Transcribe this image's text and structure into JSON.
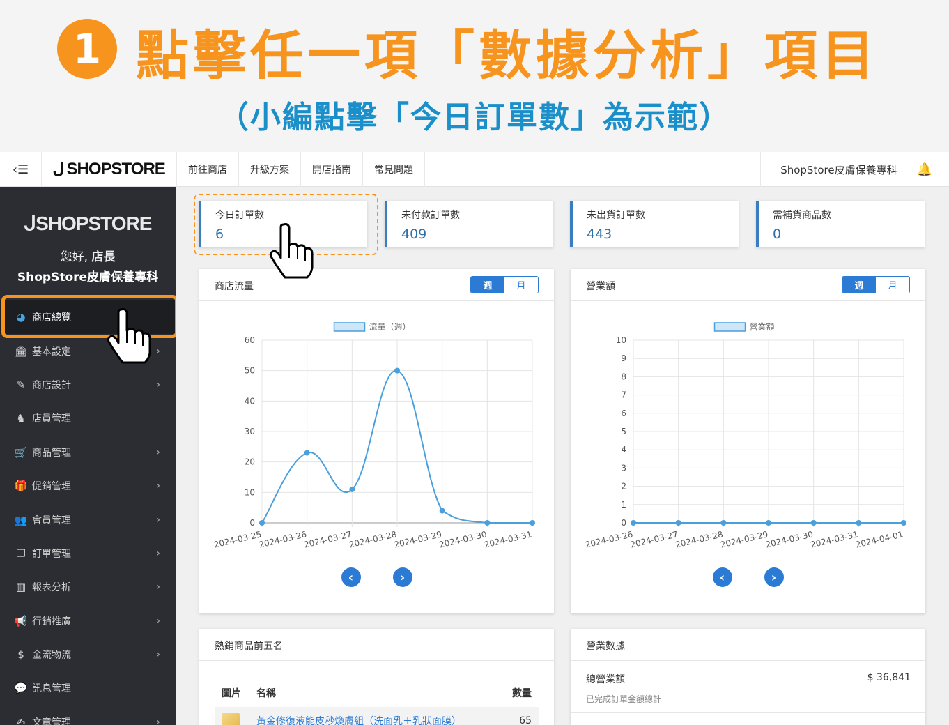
{
  "banner": {
    "step": "1",
    "title": "點擊任一項「數據分析」項目",
    "subtitle": "（小編點擊「今日訂單數」為示範）"
  },
  "topbar": {
    "logo": "SHOPSTORE",
    "nav": [
      "前往商店",
      "升級方案",
      "開店指南",
      "常見問題"
    ],
    "store_name": "ShopStore皮膚保養專科"
  },
  "sidebar": {
    "logo": "SHOPSTORE",
    "greeting_prefix": "您好, ",
    "greeting_role": "店長",
    "store_name": "ShopStore皮膚保養專科",
    "items": [
      {
        "label": "商店總覽",
        "icon": "dashboard-icon",
        "arrow": false,
        "active": true
      },
      {
        "label": "基本設定",
        "icon": "bank-icon",
        "arrow": true
      },
      {
        "label": "商店設計",
        "icon": "magic-wand-icon",
        "arrow": true
      },
      {
        "label": "店員管理",
        "icon": "user-lock-icon",
        "arrow": false
      },
      {
        "label": "商品管理",
        "icon": "cart-icon",
        "arrow": true
      },
      {
        "label": "促銷管理",
        "icon": "gift-icon",
        "arrow": true
      },
      {
        "label": "會員管理",
        "icon": "users-icon",
        "arrow": true
      },
      {
        "label": "訂單管理",
        "icon": "orders-icon",
        "arrow": true
      },
      {
        "label": "報表分析",
        "icon": "bar-chart-icon",
        "arrow": true
      },
      {
        "label": "行銷推廣",
        "icon": "megaphone-icon",
        "arrow": true
      },
      {
        "label": "金流物流",
        "icon": "dollar-icon",
        "arrow": true
      },
      {
        "label": "訊息管理",
        "icon": "chat-icon",
        "arrow": false
      },
      {
        "label": "文章管理",
        "icon": "edit-icon",
        "arrow": true
      }
    ]
  },
  "stats": [
    {
      "label": "今日訂單數",
      "value": "6"
    },
    {
      "label": "未付款訂單數",
      "value": "409"
    },
    {
      "label": "未出貨訂單數",
      "value": "443"
    },
    {
      "label": "需補貨商品數",
      "value": "0"
    }
  ],
  "toggle": {
    "week": "週",
    "month": "月"
  },
  "traffic_card": {
    "title": "商店流量"
  },
  "sales_card": {
    "title": "營業額"
  },
  "chart_data": [
    {
      "type": "line",
      "legend": "流量（週）",
      "x": [
        "2024-03-25",
        "2024-03-26",
        "2024-03-27",
        "2024-03-28",
        "2024-03-29",
        "2024-03-30",
        "2024-03-31"
      ],
      "series": [
        {
          "name": "流量（週）",
          "values": [
            0,
            23,
            11,
            50,
            4,
            0,
            0
          ]
        }
      ],
      "ylim": [
        0,
        60
      ],
      "yticks": [
        0,
        10,
        20,
        30,
        40,
        50,
        60
      ],
      "grid": true,
      "legend_position": "top",
      "color": "#4a9fdc"
    },
    {
      "type": "line",
      "legend": "營業額",
      "x": [
        "2024-03-26",
        "2024-03-27",
        "2024-03-28",
        "2024-03-29",
        "2024-03-30",
        "2024-03-31",
        "2024-04-01"
      ],
      "series": [
        {
          "name": "營業額",
          "values": [
            0,
            0,
            0,
            0,
            0,
            0,
            0
          ]
        }
      ],
      "ylim": [
        0,
        10
      ],
      "yticks": [
        0,
        1,
        2,
        3,
        4,
        5,
        6,
        7,
        8,
        9,
        10
      ],
      "grid": true,
      "legend_position": "top",
      "color": "#4a9fdc"
    }
  ],
  "top5": {
    "title": "熱銷商品前五名",
    "headers": {
      "image": "圖片",
      "name": "名稱",
      "qty": "數量"
    },
    "rows": [
      {
        "name": "黃金修復液能皮秒煥膚組（洗面乳＋乳狀面膜）",
        "qty": "65"
      }
    ]
  },
  "revenue": {
    "title": "營業數據",
    "total_label": "總營業額",
    "total_value": "$ 36,841",
    "total_note": "已完成訂單金額總計"
  }
}
